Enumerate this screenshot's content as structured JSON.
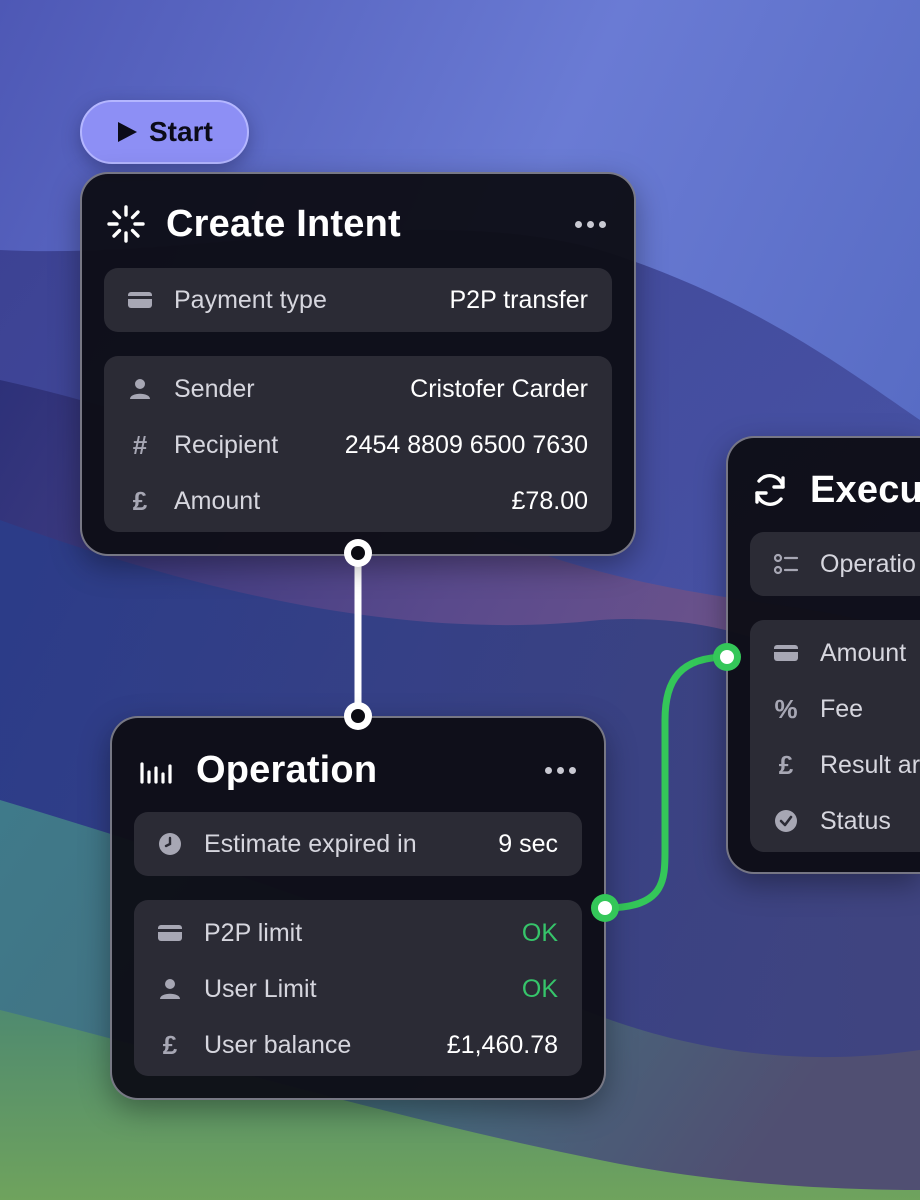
{
  "start_button": {
    "label": "Start"
  },
  "create_intent": {
    "title": "Create Intent",
    "payment_type": {
      "label": "Payment type",
      "value": "P2P transfer"
    },
    "rows": [
      {
        "icon": "user-icon",
        "label": "Sender",
        "value": "Cristofer Carder"
      },
      {
        "icon": "hash-icon",
        "label": "Recipient",
        "value": "2454 8809 6500 7630"
      },
      {
        "icon": "pound-icon",
        "label": "Amount",
        "value": "£78.00"
      }
    ]
  },
  "operation": {
    "title": "Operation",
    "estimate": {
      "label": "Estimate expired in",
      "value": "9 sec"
    },
    "rows": [
      {
        "icon": "card-icon",
        "label": "P2P limit",
        "value": "OK"
      },
      {
        "icon": "user-icon",
        "label": "User Limit",
        "value": "OK"
      },
      {
        "icon": "pound-icon",
        "label": "User balance",
        "value": "£1,460.78"
      }
    ]
  },
  "execute": {
    "title": "Execut",
    "operation_row": {
      "label": "Operatio"
    },
    "rows": [
      {
        "icon": "card-icon",
        "label": "Amount"
      },
      {
        "icon": "percent-icon",
        "label": "Fee"
      },
      {
        "icon": "pound-icon",
        "label": "Result ar"
      },
      {
        "icon": "check-circle-icon",
        "label": "Status"
      }
    ]
  },
  "colors": {
    "accent": "#8d8ff5",
    "ok_green": "#36c46a",
    "connector_green": "#34c759",
    "card_bg": "#0e0e16",
    "panel_bg": "#2b2b35"
  }
}
